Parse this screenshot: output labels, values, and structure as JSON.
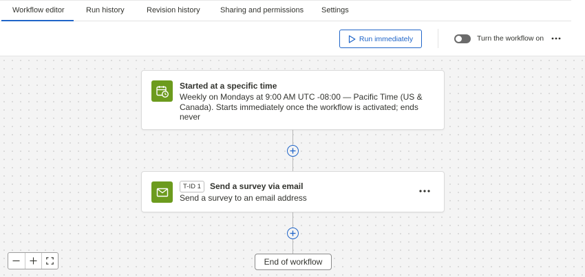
{
  "tabs": [
    {
      "label": "Workflow editor",
      "active": true
    },
    {
      "label": "Run history"
    },
    {
      "label": "Revision history"
    },
    {
      "label": "Sharing and permissions"
    },
    {
      "label": "Settings"
    }
  ],
  "toolbar": {
    "run_label": "Run immediately",
    "toggle_label": "Turn the workflow on",
    "toggle_on": false
  },
  "trigger": {
    "icon": "calendar-clock-icon",
    "title": "Started at a specific time",
    "description": "Weekly on Mondays at 9:00 AM UTC -08:00 — Pacific Time (US & Canada). Starts immediately once the workflow is activated; ends never"
  },
  "task": {
    "icon": "envelope-icon",
    "badge": "T-ID 1",
    "title": "Send a survey via email",
    "description": "Send a survey to an email address"
  },
  "end_label": "End of workflow",
  "colors": {
    "accent": "#1e64c8",
    "task_icon_bg": "#6c9b1e",
    "canvas_bg": "#f4f4f4"
  }
}
